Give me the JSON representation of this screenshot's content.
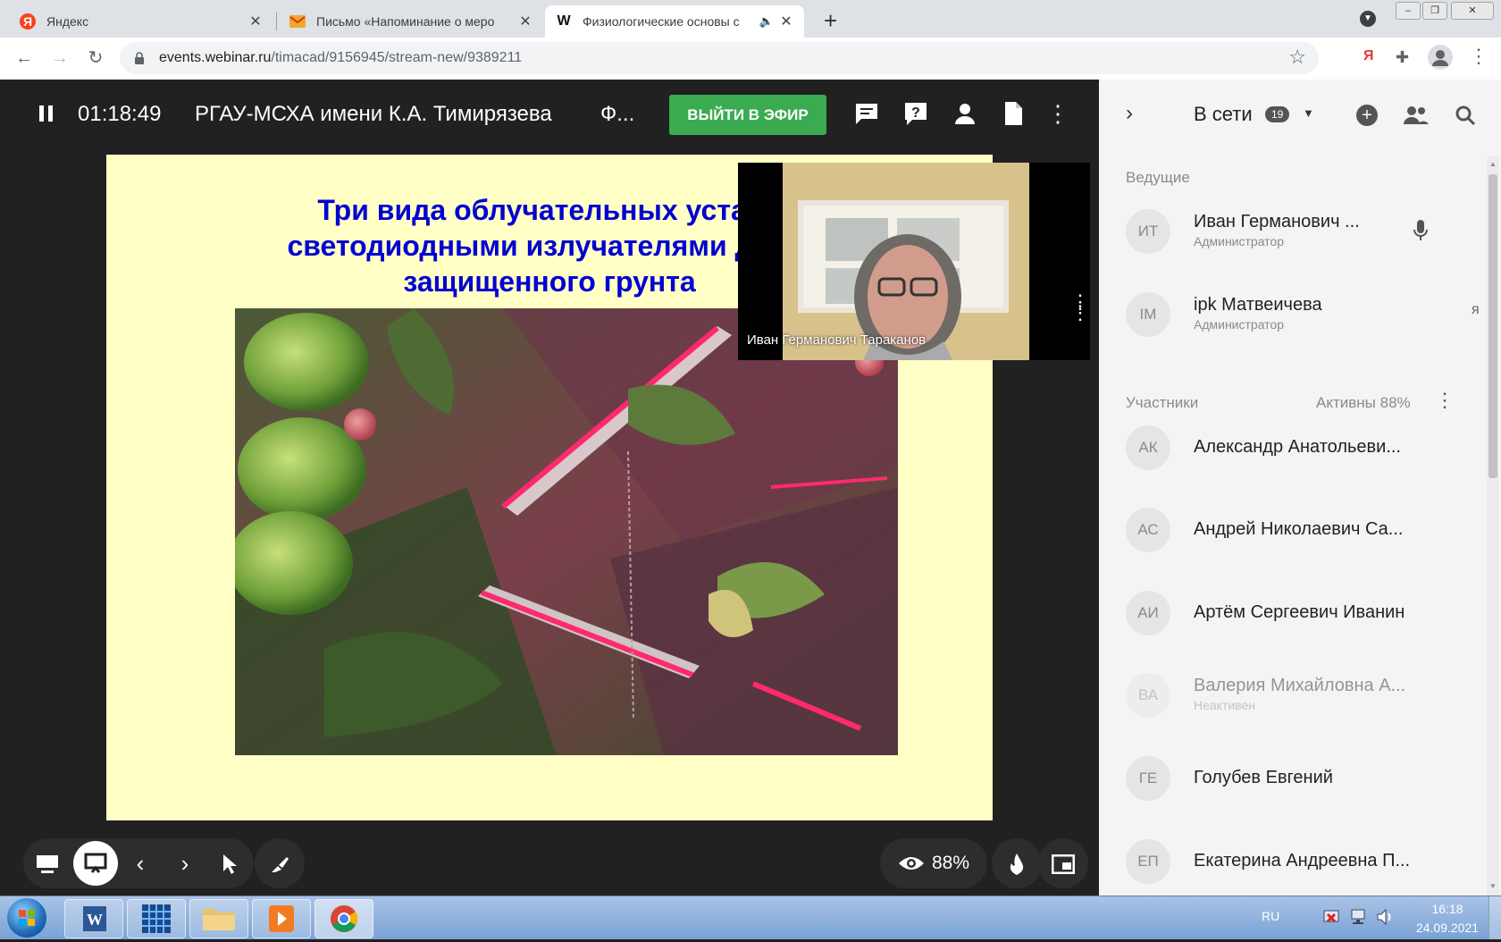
{
  "browser": {
    "tabs": [
      {
        "title": "Яндекс",
        "favicon": "Я"
      },
      {
        "title": "Письмо «Напоминание о меро",
        "favicon": "mail-icon"
      },
      {
        "title": "Физиологические основы с",
        "favicon": "W",
        "audio": true
      }
    ],
    "new_tab": "+",
    "url_domain": "events.webinar.ru",
    "url_path": "/timacad/9156945/stream-new/9389211",
    "yandex_ext": "Я"
  },
  "webinar": {
    "timer": "01:18:49",
    "title": "РГАУ-МСХА имени К.А. Тимирязева",
    "title_more": "Ф...",
    "on_air_label": "ВЫЙТИ В ЭФИР",
    "slide": {
      "title_line1": "Три вида облучательных устано",
      "title_line2": "светодиодными излучателями для с",
      "title_line3": "защищенного грунта"
    },
    "speaker": {
      "name": "Иван Германович Тараканов"
    },
    "visibility": "88%"
  },
  "panel": {
    "online_label": "В сети",
    "online_count": "19",
    "hosts_label": "Ведущие",
    "hosts": [
      {
        "initials": "ИТ",
        "name": "Иван Германович ...",
        "role": "Администратор"
      },
      {
        "initials": "IM",
        "name": "ipk Матвеичева",
        "role": "Администратор",
        "me": "я"
      }
    ],
    "participants_label": "Участники",
    "active_label": "Активны 88%",
    "participants": [
      {
        "initials": "АК",
        "name": "Александр Анатольеви..."
      },
      {
        "initials": "АС",
        "name": "Андрей Николаевич Са..."
      },
      {
        "initials": "АИ",
        "name": "Артём Сергеевич Иванин"
      },
      {
        "initials": "ВА",
        "name": "Валерия Михайловна А...",
        "status": "Неактивен"
      },
      {
        "initials": "ГЕ",
        "name": "Голубев Евгений"
      },
      {
        "initials": "ЕП",
        "name": "Екатерина Андреевна П..."
      }
    ]
  },
  "taskbar": {
    "lang": "RU",
    "time": "16:18",
    "date": "24.09.2021"
  }
}
